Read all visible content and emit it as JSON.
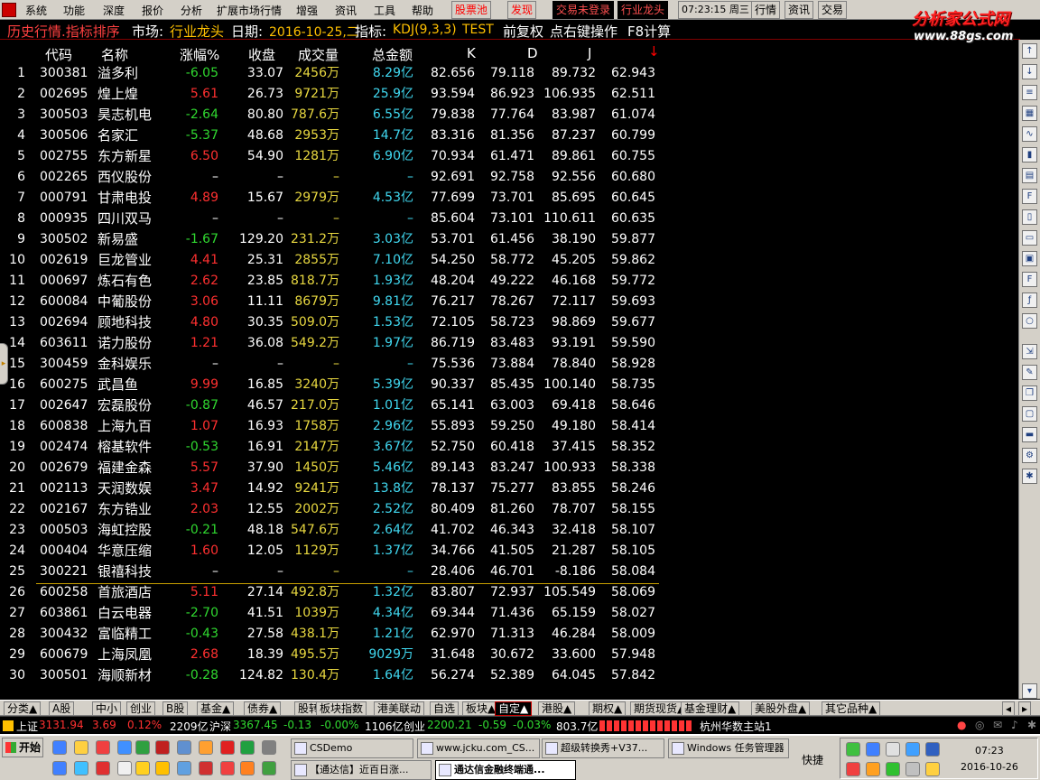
{
  "menubar": {
    "items": [
      "系统",
      "功能",
      "深度",
      "报价",
      "分析",
      "扩展市场行情",
      "增强",
      "资讯",
      "工具",
      "帮助"
    ],
    "stock_pool": "股票池",
    "discover": "发现",
    "trade_status": "交易未登录",
    "industry_leader": "行业龙头",
    "time": "07:23:15 周三",
    "right_buttons": [
      "行情",
      "资讯",
      "交易"
    ]
  },
  "brand": {
    "name": "分析家公式网",
    "url": "www.88gs.com"
  },
  "title": {
    "view": "历史行情.指标排序",
    "market_label": "市场:",
    "market_value": "行业龙头",
    "date_label": "日期:",
    "date_value": "2016-10-25,二",
    "indicator_label": "指标:",
    "indicator_value": "KDJ(9,3,3)",
    "test": "TEST",
    "adjust": "前复权",
    "hint": "点右键操作",
    "f8": "F8计算"
  },
  "table": {
    "headers": [
      "代码",
      "名称",
      "涨幅%",
      "收盘",
      "成交量",
      "总金额",
      "K",
      "D",
      "J"
    ],
    "sort_arrow": "↓",
    "rows": [
      {
        "idx": "1",
        "code": "300381",
        "name": "溢多利",
        "chg": "-6.05",
        "dir": "dn",
        "close": "33.07",
        "vol": "2456万",
        "amt": "8.29亿",
        "k": "82.656",
        "d": "79.118",
        "j": "89.732",
        "kdj": "62.943"
      },
      {
        "idx": "2",
        "code": "002695",
        "name": "煌上煌",
        "chg": "5.61",
        "dir": "up",
        "close": "26.73",
        "vol": "9721万",
        "amt": "25.9亿",
        "k": "93.594",
        "d": "86.923",
        "j": "106.935",
        "kdj": "62.511"
      },
      {
        "idx": "3",
        "code": "300503",
        "name": "昊志机电",
        "chg": "-2.64",
        "dir": "dn",
        "close": "80.80",
        "vol": "787.6万",
        "amt": "6.55亿",
        "k": "79.838",
        "d": "77.764",
        "j": "83.987",
        "kdj": "61.074"
      },
      {
        "idx": "4",
        "code": "300506",
        "name": "名家汇",
        "chg": "-5.37",
        "dir": "dn",
        "close": "48.68",
        "vol": "2953万",
        "amt": "14.7亿",
        "k": "83.316",
        "d": "81.356",
        "j": "87.237",
        "kdj": "60.799"
      },
      {
        "idx": "5",
        "code": "002755",
        "name": "东方新星",
        "chg": "6.50",
        "dir": "up",
        "close": "54.90",
        "vol": "1281万",
        "amt": "6.90亿",
        "k": "70.934",
        "d": "61.471",
        "j": "89.861",
        "kdj": "60.755"
      },
      {
        "idx": "6",
        "code": "002265",
        "name": "西仪股份",
        "chg": "–",
        "dir": "nc",
        "close": "–",
        "vol": "–",
        "amt": "–",
        "k": "92.691",
        "d": "92.758",
        "j": "92.556",
        "kdj": "60.680"
      },
      {
        "idx": "7",
        "code": "000791",
        "name": "甘肃电投",
        "chg": "4.89",
        "dir": "up",
        "close": "15.67",
        "vol": "2979万",
        "amt": "4.53亿",
        "k": "77.699",
        "d": "73.701",
        "j": "85.695",
        "kdj": "60.645"
      },
      {
        "idx": "8",
        "code": "000935",
        "name": "四川双马",
        "chg": "–",
        "dir": "nc",
        "close": "–",
        "vol": "–",
        "amt": "–",
        "k": "85.604",
        "d": "73.101",
        "j": "110.611",
        "kdj": "60.635"
      },
      {
        "idx": "9",
        "code": "300502",
        "name": "新易盛",
        "chg": "-1.67",
        "dir": "dn",
        "close": "129.20",
        "vol": "231.2万",
        "amt": "3.03亿",
        "k": "53.701",
        "d": "61.456",
        "j": "38.190",
        "kdj": "59.877"
      },
      {
        "idx": "10",
        "code": "002619",
        "name": "巨龙管业",
        "chg": "4.41",
        "dir": "up",
        "close": "25.31",
        "vol": "2855万",
        "amt": "7.10亿",
        "k": "54.250",
        "d": "58.772",
        "j": "45.205",
        "kdj": "59.862"
      },
      {
        "idx": "11",
        "code": "000697",
        "name": "炼石有色",
        "chg": "2.62",
        "dir": "up",
        "close": "23.85",
        "vol": "818.7万",
        "amt": "1.93亿",
        "k": "48.204",
        "d": "49.222",
        "j": "46.168",
        "kdj": "59.772"
      },
      {
        "idx": "12",
        "code": "600084",
        "name": "中葡股份",
        "chg": "3.06",
        "dir": "up",
        "close": "11.11",
        "vol": "8679万",
        "amt": "9.81亿",
        "k": "76.217",
        "d": "78.267",
        "j": "72.117",
        "kdj": "59.693"
      },
      {
        "idx": "13",
        "code": "002694",
        "name": "顾地科技",
        "chg": "4.80",
        "dir": "up",
        "close": "30.35",
        "vol": "509.0万",
        "amt": "1.53亿",
        "k": "72.105",
        "d": "58.723",
        "j": "98.869",
        "kdj": "59.677"
      },
      {
        "idx": "14",
        "code": "603611",
        "name": "诺力股份",
        "chg": "1.21",
        "dir": "up",
        "close": "36.08",
        "vol": "549.2万",
        "amt": "1.97亿",
        "k": "86.719",
        "d": "83.483",
        "j": "93.191",
        "kdj": "59.590"
      },
      {
        "idx": "15",
        "code": "300459",
        "name": "金科娱乐",
        "chg": "–",
        "dir": "nc",
        "close": "–",
        "vol": "–",
        "amt": "–",
        "k": "75.536",
        "d": "73.884",
        "j": "78.840",
        "kdj": "58.928"
      },
      {
        "idx": "16",
        "code": "600275",
        "name": "武昌鱼",
        "chg": "9.99",
        "dir": "up",
        "close": "16.85",
        "vol": "3240万",
        "amt": "5.39亿",
        "k": "90.337",
        "d": "85.435",
        "j": "100.140",
        "kdj": "58.735"
      },
      {
        "idx": "17",
        "code": "002647",
        "name": "宏磊股份",
        "chg": "-0.87",
        "dir": "dn",
        "close": "46.57",
        "vol": "217.0万",
        "amt": "1.01亿",
        "k": "65.141",
        "d": "63.003",
        "j": "69.418",
        "kdj": "58.646"
      },
      {
        "idx": "18",
        "code": "600838",
        "name": "上海九百",
        "chg": "1.07",
        "dir": "up",
        "close": "16.93",
        "vol": "1758万",
        "amt": "2.96亿",
        "k": "55.893",
        "d": "59.250",
        "j": "49.180",
        "kdj": "58.414"
      },
      {
        "idx": "19",
        "code": "002474",
        "name": "榕基软件",
        "chg": "-0.53",
        "dir": "dn",
        "close": "16.91",
        "vol": "2147万",
        "amt": "3.67亿",
        "k": "52.750",
        "d": "60.418",
        "j": "37.415",
        "kdj": "58.352"
      },
      {
        "idx": "20",
        "code": "002679",
        "name": "福建金森",
        "chg": "5.57",
        "dir": "up",
        "close": "37.90",
        "vol": "1450万",
        "amt": "5.46亿",
        "k": "89.143",
        "d": "83.247",
        "j": "100.933",
        "kdj": "58.338"
      },
      {
        "idx": "21",
        "code": "002113",
        "name": "天润数娱",
        "chg": "3.47",
        "dir": "up",
        "close": "14.92",
        "vol": "9241万",
        "amt": "13.8亿",
        "k": "78.137",
        "d": "75.277",
        "j": "83.855",
        "kdj": "58.246"
      },
      {
        "idx": "22",
        "code": "002167",
        "name": "东方锆业",
        "chg": "2.03",
        "dir": "up",
        "close": "12.55",
        "vol": "2002万",
        "amt": "2.52亿",
        "k": "80.409",
        "d": "81.260",
        "j": "78.707",
        "kdj": "58.155"
      },
      {
        "idx": "23",
        "code": "000503",
        "name": "海虹控股",
        "chg": "-0.21",
        "dir": "dn",
        "close": "48.18",
        "vol": "547.6万",
        "amt": "2.64亿",
        "k": "41.702",
        "d": "46.343",
        "j": "32.418",
        "kdj": "58.107"
      },
      {
        "idx": "24",
        "code": "000404",
        "name": "华意压缩",
        "chg": "1.60",
        "dir": "up",
        "close": "12.05",
        "vol": "1129万",
        "amt": "1.37亿",
        "k": "34.766",
        "d": "41.505",
        "j": "21.287",
        "kdj": "58.105"
      },
      {
        "idx": "25",
        "code": "300221",
        "name": "银禧科技",
        "chg": "–",
        "dir": "nc",
        "close": "–",
        "vol": "–",
        "amt": "–",
        "k": "28.406",
        "d": "46.701",
        "j": "-8.186",
        "kdj": "58.084"
      },
      {
        "idx": "26",
        "code": "600258",
        "name": "首旅酒店",
        "chg": "5.11",
        "dir": "up",
        "close": "27.14",
        "vol": "492.8万",
        "amt": "1.32亿",
        "k": "83.807",
        "d": "72.937",
        "j": "105.549",
        "kdj": "58.069"
      },
      {
        "idx": "27",
        "code": "603861",
        "name": "白云电器",
        "chg": "-2.70",
        "dir": "dn",
        "close": "41.51",
        "vol": "1039万",
        "amt": "4.34亿",
        "k": "69.344",
        "d": "71.436",
        "j": "65.159",
        "kdj": "58.027"
      },
      {
        "idx": "28",
        "code": "300432",
        "name": "富临精工",
        "chg": "-0.43",
        "dir": "dn",
        "close": "27.58",
        "vol": "438.1万",
        "amt": "1.21亿",
        "k": "62.970",
        "d": "71.313",
        "j": "46.284",
        "kdj": "58.009"
      },
      {
        "idx": "29",
        "code": "600679",
        "name": "上海凤凰",
        "chg": "2.68",
        "dir": "up",
        "close": "18.39",
        "vol": "495.5万",
        "amt": "9029万",
        "k": "31.648",
        "d": "30.672",
        "j": "33.600",
        "kdj": "57.948"
      },
      {
        "idx": "30",
        "code": "300501",
        "name": "海顺新材",
        "chg": "-0.28",
        "dir": "dn",
        "close": "124.82",
        "vol": "130.4万",
        "amt": "1.64亿",
        "k": "56.274",
        "d": "52.389",
        "j": "64.045",
        "kdj": "57.842"
      }
    ]
  },
  "tabs": [
    "分类▲",
    "A股",
    "中小",
    "创业",
    "B股",
    "基金▲",
    "债券▲",
    "股转▲",
    "板块指数",
    "港美联动",
    "自选",
    "板块▲",
    "自定▲",
    "港股▲",
    "期权▲",
    "期货现货▲",
    "基金理财▲",
    "美股外盘▲",
    "其它品种▲"
  ],
  "active_tab": "自定▲",
  "status": {
    "sh_label": "上证",
    "sh_index": "3131.94",
    "sh_chg": "3.69",
    "sh_pct": "0.12%",
    "sh_amt": "2209亿",
    "hs_label": "沪深",
    "hs_index": "3367.45",
    "hs_chg": "-0.13",
    "hs_pct": "-0.00%",
    "hs_amt": "1106亿",
    "cy_label": "创业",
    "cy_index": "2200.21",
    "cy_chg": "-0.59",
    "cy_pct": "-0.03%",
    "cy_amt": "803.7亿",
    "server": "杭州华数主站1"
  },
  "taskbar": {
    "start": "开始",
    "windows": [
      "CSDemo",
      "www.jcku.com_CS...",
      "超级转换秀+V37...",
      "Windows 任务管理器",
      "【通达信】近百日涨...",
      "通达信金融终端通..."
    ],
    "quick": "快捷",
    "time": "07:23",
    "date": "2016-10-26"
  },
  "colors": {
    "up": "#ff3030",
    "down": "#30d830",
    "volume": "#e8d840",
    "amount": "#40d8f0",
    "title": "#ff4040",
    "accent": "#ffc000"
  }
}
